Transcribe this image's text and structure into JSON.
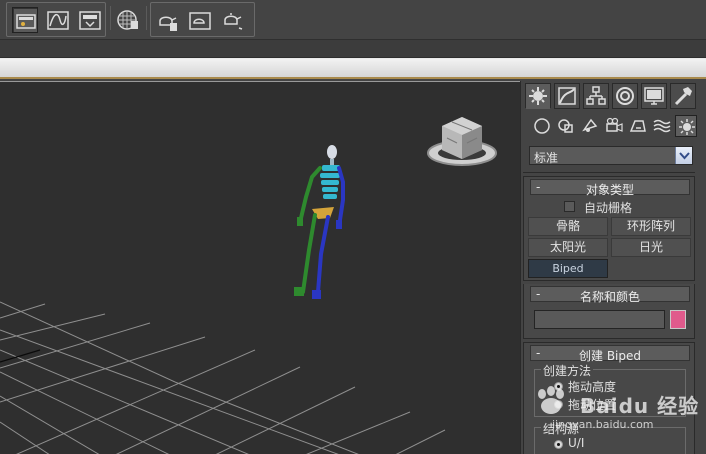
{
  "toolbar": {
    "group1_buttons": [
      "scene-explorer-icon",
      "curve-editor-icon",
      "render-setup-icon"
    ],
    "group2_buttons": [
      "material-editor-icon"
    ],
    "group3_buttons": [
      "render-frame-icon",
      "rendered-frame-window-icon",
      "render-teapot-icon"
    ]
  },
  "viewport": {
    "label": "",
    "viewcube": "viewcube-icon"
  },
  "command_panel": {
    "tabs": [
      "create-tab-icon",
      "modify-tab-icon",
      "hierarchy-tab-icon",
      "motion-tab-icon",
      "display-tab-icon",
      "utilities-tab-icon"
    ],
    "subtabs": [
      "geometry-icon",
      "shapes-icon",
      "lights-icon",
      "cameras-icon",
      "helpers-icon",
      "space-warps-icon",
      "systems-icon"
    ],
    "category_dropdown": "标准",
    "object_type": {
      "title": "对象类型",
      "minus": "-",
      "autogrid_label": "自动栅格",
      "buttons": [
        "骨骼",
        "环形阵列",
        "太阳光",
        "日光",
        "Biped"
      ]
    },
    "name_color": {
      "title": "名称和颜色",
      "minus": "-",
      "name_value": "",
      "swatch_color": "#e05a8c"
    },
    "create_biped": {
      "title": "创建 Biped",
      "minus": "-",
      "creation_method_group": "创建方法",
      "method_option_1": "拖动高度",
      "method_option_2": "拖动位置",
      "structure_group": "结构源",
      "structure_option_1": "U/I"
    }
  },
  "watermark": {
    "brand": "Baidu 经验",
    "url": "jingyan.baidu.com"
  },
  "colors": {
    "viewport_bg": "#2f2f2f",
    "panel_bg": "#444444",
    "accent_orange": "#a98a4c",
    "biped_left": "#2e8a2e",
    "biped_right": "#2a36c2",
    "biped_spine": "#34b8d0",
    "biped_pelvis": "#d4a43a"
  }
}
